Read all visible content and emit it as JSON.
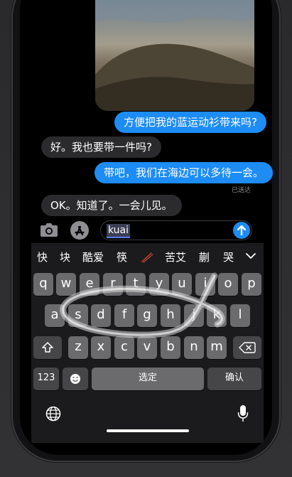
{
  "messages": [
    {
      "text": "方便把我的蓝运动衫带来吗?",
      "direction": "outgoing"
    },
    {
      "text": "好。我也要带一件吗?",
      "direction": "incoming"
    },
    {
      "text": "带吧，我们在海边可以多待一会。",
      "direction": "outgoing"
    },
    {
      "text": "OK。知道了。一会儿见。",
      "direction": "incoming"
    }
  ],
  "delivered_label": "已送达",
  "input": {
    "value": "kuai"
  },
  "candidates": [
    "快",
    "块",
    "酷爱",
    "筷",
    "苦艾",
    "蒯",
    "哭"
  ],
  "keyboard": {
    "row1": [
      "q",
      "w",
      "e",
      "r",
      "t",
      "y",
      "u",
      "i",
      "o",
      "p"
    ],
    "row2": [
      "a",
      "s",
      "d",
      "f",
      "g",
      "h",
      "j",
      "k",
      "l"
    ],
    "row3": [
      "z",
      "x",
      "c",
      "v",
      "b",
      "n",
      "m"
    ],
    "numbers_key": "123",
    "space_key": "选定",
    "return_key": "确认"
  },
  "icons": {
    "camera": "camera-icon",
    "appstore": "app-store-icon",
    "send": "send-arrow-icon",
    "handwriting": "handwriting-icon",
    "expand": "chevron-down-icon",
    "shift": "shift-icon",
    "delete": "delete-icon",
    "emoji": "emoji-icon",
    "globe": "globe-icon",
    "mic": "microphone-icon"
  },
  "colors": {
    "accent": "#1d8cf5",
    "incoming": "#2b2b2e",
    "key": "#6b6b6e",
    "key_dark": "#464648"
  }
}
